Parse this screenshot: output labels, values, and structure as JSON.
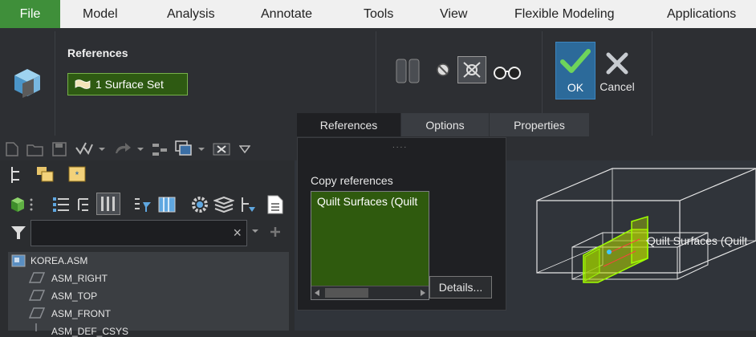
{
  "menu": {
    "file": "File",
    "model": "Model",
    "analysis": "Analysis",
    "annotate": "Annotate",
    "tools": "Tools",
    "view": "View",
    "flexible_modeling": "Flexible Modeling",
    "applications": "Applications"
  },
  "ribbon": {
    "references_heading": "References",
    "surface_set": "1 Surface Set",
    "ok": "OK",
    "cancel": "Cancel"
  },
  "tabs": {
    "references": "References",
    "options": "Options",
    "properties": "Properties"
  },
  "popup": {
    "copy_references": "Copy references",
    "quilt_item": "Quilt Surfaces (Quilt",
    "details": "Details..."
  },
  "tree": {
    "root": "KOREA.ASM",
    "items": [
      "ASM_RIGHT",
      "ASM_TOP",
      "ASM_FRONT",
      "ASM_DEF_CSYS"
    ]
  },
  "viewport": {
    "label": "Quilt Surfaces (Quilt"
  },
  "colors": {
    "accent_green": "#3f8f3a",
    "selection_green": "#2f5a0e",
    "ok_blue": "#2c6a9a"
  }
}
